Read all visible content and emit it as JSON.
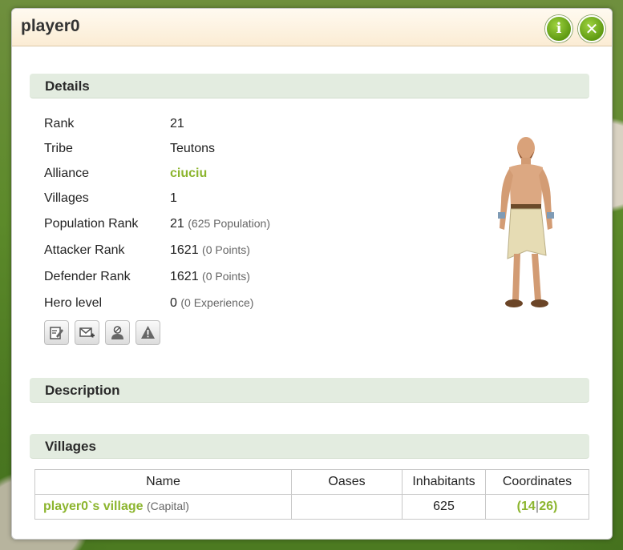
{
  "window": {
    "title": "player0",
    "info_button": "i",
    "close_button": "✕"
  },
  "details": {
    "heading": "Details",
    "rows": [
      {
        "label": "Rank",
        "value": "21",
        "extra": ""
      },
      {
        "label": "Tribe",
        "value": "Teutons",
        "extra": ""
      },
      {
        "label": "Alliance",
        "value": "ciuciu",
        "extra": ""
      },
      {
        "label": "Villages",
        "value": "1",
        "extra": ""
      },
      {
        "label": "Population Rank",
        "value": "21",
        "extra": "(625 Population)"
      },
      {
        "label": "Attacker Rank",
        "value": "1621",
        "extra": "(0 Points)"
      },
      {
        "label": "Defender Rank",
        "value": "1621",
        "extra": "(0 Points)"
      },
      {
        "label": "Hero level",
        "value": "0",
        "extra": "(0 Experience)"
      }
    ],
    "action_icons": [
      "edit-note-icon",
      "send-message-icon",
      "player-profile-icon",
      "report-icon"
    ]
  },
  "description": {
    "heading": "Description"
  },
  "villages": {
    "heading": "Villages",
    "columns": [
      "Name",
      "Oases",
      "Inhabitants",
      "Coordinates"
    ],
    "rows": [
      {
        "name": "player0`s village",
        "tag": "(Capital)",
        "oases": "",
        "inhabitants": "625",
        "x": "14",
        "y": "26"
      }
    ]
  },
  "colors": {
    "accent": "#8cb52e",
    "section_bg": "#e3ece0",
    "title_bg": "#fbecd4"
  }
}
